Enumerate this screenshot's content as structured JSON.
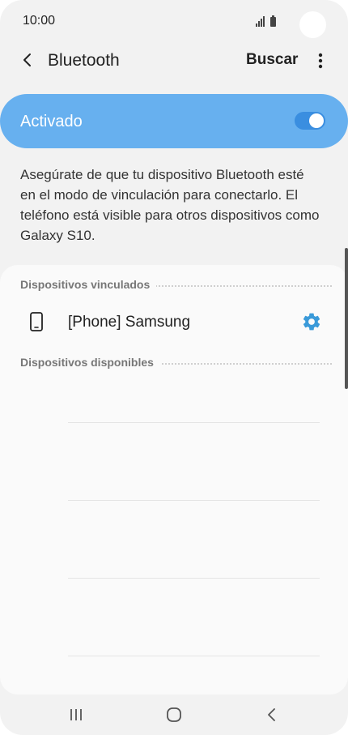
{
  "status_bar": {
    "time": "10:00"
  },
  "header": {
    "title": "Bluetooth",
    "search_label": "Buscar"
  },
  "master_switch": {
    "label": "Activado",
    "on": true,
    "accent_color": "#67b0ef"
  },
  "description": "Asegúrate de que tu dispositivo Bluetooth esté en el modo de vinculación para conectarlo. El teléfono está visible para otros dispositivos como Galaxy S10.",
  "paired_section": {
    "title": "Dispositivos vinculados",
    "devices": [
      {
        "name": "[Phone] Samsung",
        "icon": "smartphone-icon"
      }
    ]
  },
  "available_section": {
    "title": "Dispositivos disponibles",
    "devices": []
  },
  "nav": {
    "icons": [
      "recents-icon",
      "home-icon",
      "back-icon"
    ]
  }
}
